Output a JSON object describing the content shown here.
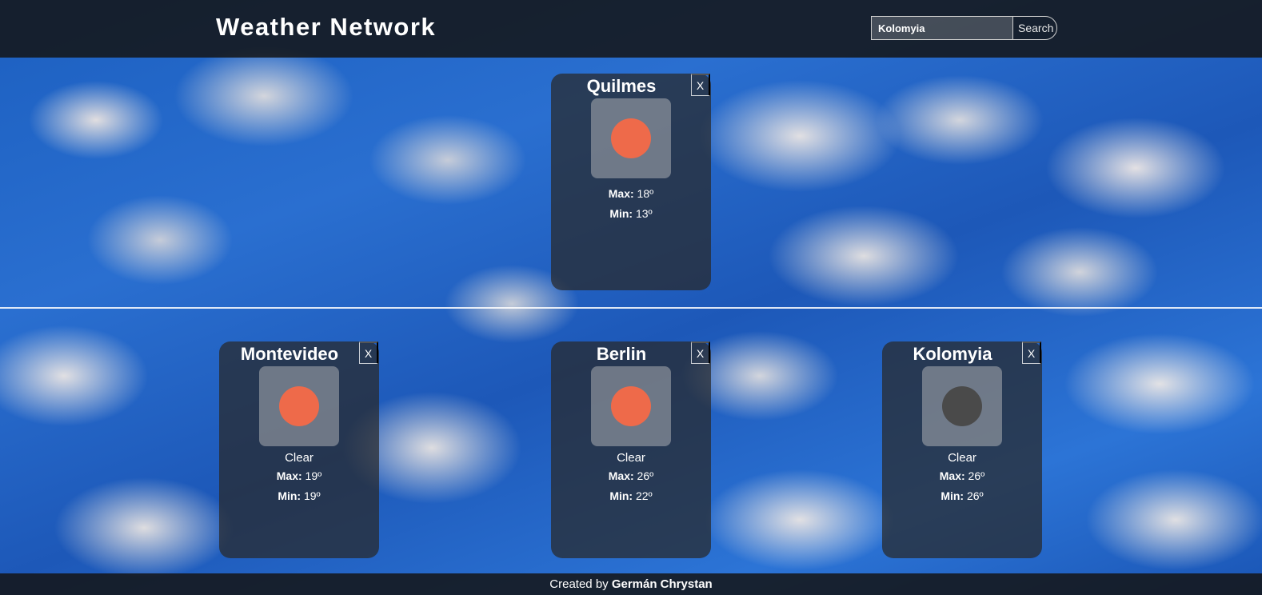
{
  "header": {
    "title": "Weather Network",
    "search_value": "Kolomyia",
    "search_button": "Search"
  },
  "featured": {
    "city": "Quilmes",
    "close": "X",
    "icon": "sun-icon",
    "max_label": "Max:",
    "max_value": "18º",
    "min_label": "Min:",
    "min_value": "13º"
  },
  "cities": [
    {
      "city": "Montevideo",
      "close": "X",
      "icon": "sun-icon",
      "condition": "Clear",
      "max_label": "Max:",
      "max_value": "19º",
      "min_label": "Min:",
      "min_value": "19º"
    },
    {
      "city": "Berlin",
      "close": "X",
      "icon": "sun-icon",
      "condition": "Clear",
      "max_label": "Max:",
      "max_value": "26º",
      "min_label": "Min:",
      "min_value": "22º"
    },
    {
      "city": "Kolomyia",
      "close": "X",
      "icon": "moon-icon",
      "condition": "Clear",
      "max_label": "Max:",
      "max_value": "26º",
      "min_label": "Min:",
      "min_value": "26º"
    }
  ],
  "footer": {
    "prefix": "Created by ",
    "author": "Germán Chrystan"
  },
  "colors": {
    "sun": "#ee6a4a",
    "moon": "#4a4a4a",
    "bar": "#141414"
  }
}
